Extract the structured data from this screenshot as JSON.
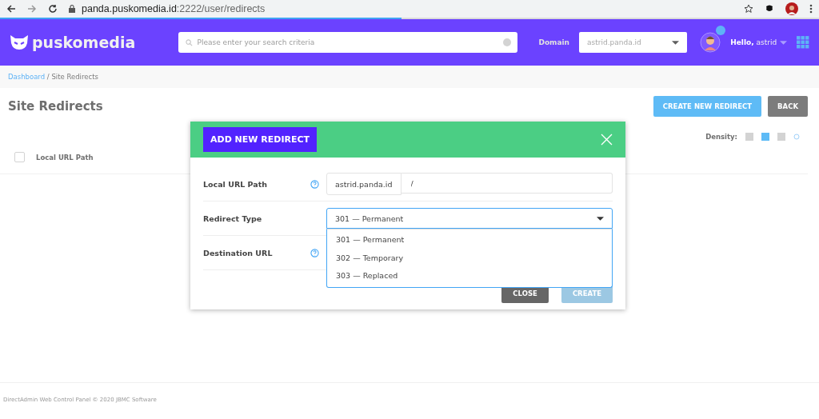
{
  "browser": {
    "url_host": "panda.puskomedia.id",
    "url_rest": ":2222/user/redirects",
    "progress": {
      "level": 0.49
    }
  },
  "header": {
    "logo": "puskomedia",
    "search": {
      "placeholder": "Please enter your search criteria"
    },
    "domain_label": "Domain",
    "domain_select": "astrid.panda.id",
    "greeting": "**Hello,** astrid"
  },
  "breadcrumb": {
    "link": "Dashboard",
    "current": " / Site Redirects"
  },
  "page": {
    "title": "Site Redirects",
    "buttons": [
      {
        "label": "CREATE NEW REDIRECT",
        "kind": "primary"
      },
      {
        "label": "BACK",
        "kind": "secondary"
      }
    ],
    "density": {
      "label": "Density:",
      "options": [
        {
          "selected": false
        },
        {
          "selected": true
        },
        {
          "selected": false
        }
      ]
    },
    "table": {
      "columns": [
        "Local URL Path"
      ],
      "select_all": {
        "checked": false
      }
    }
  },
  "modal": {
    "tab": "ADD NEW REDIRECT",
    "fields": [
      {
        "kind": "prefixed",
        "label": "Local URL Path",
        "help": true,
        "prefix": "astrid.panda.id",
        "value": "/"
      },
      {
        "kind": "select",
        "label": "Redirect Type",
        "help": false,
        "value": "301 — Permanent",
        "expanded": true,
        "options": [
          "301 — Permanent",
          "302 — Temporary",
          "303 — Replaced"
        ]
      },
      {
        "kind": "text",
        "label": "Destination URL",
        "help": true
      }
    ],
    "buttons": [
      {
        "label": "CLOSE",
        "disabled": false,
        "kind": "secondary"
      },
      {
        "label": "CREATE",
        "disabled": true,
        "kind": "primary"
      }
    ]
  },
  "footer": "DirectAdmin Web Control Panel © 2020 JBMC Software"
}
